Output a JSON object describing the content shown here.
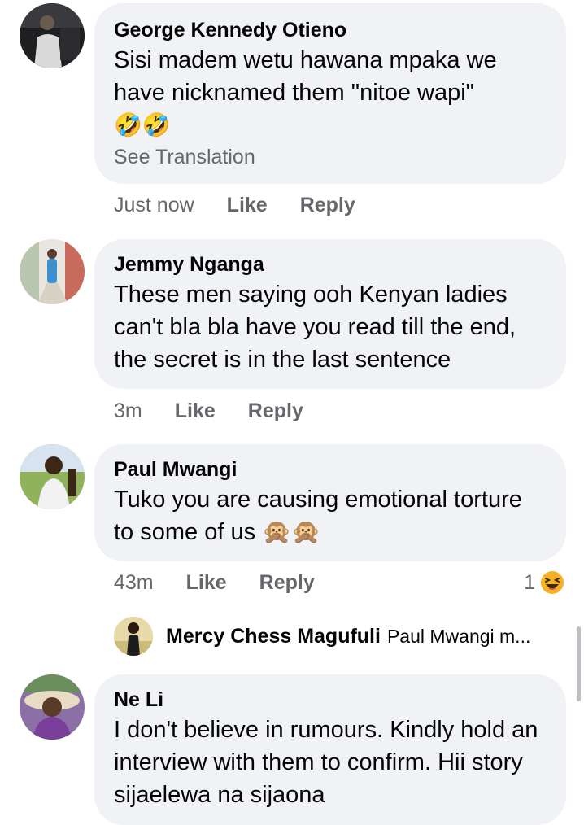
{
  "comments": [
    {
      "name": "George Kennedy Otieno",
      "text": "Sisi madem wetu hawana mpaka we have nicknamed them \"nitoe wapi\"",
      "emoji": "🤣🤣",
      "see_translation": "See Translation",
      "time": "Just now",
      "like": "Like",
      "reply": "Reply"
    },
    {
      "name": "Jemmy Nganga",
      "text": "These men saying ooh Kenyan ladies can't bla bla have you read till the end, the secret is in the last sentence",
      "time": "3m",
      "like": "Like",
      "reply": "Reply"
    },
    {
      "name": "Paul Mwangi",
      "text": "Tuko you are causing emotional torture to some of us",
      "emoji": "🙊🙊",
      "time": "43m",
      "like": "Like",
      "reply": "Reply",
      "reaction_count": "1",
      "reaction_icon": "laughing-emoji-icon",
      "reply_preview": {
        "name": "Mercy Chess Magufuli",
        "snippet": "Paul Mwangi m..."
      }
    },
    {
      "name": "Ne Li",
      "text": "I don't believe in rumours. Kindly hold an interview with them to confirm. Hii story sijaelewa na sijaona"
    }
  ],
  "colors": {
    "bubble": "#f0f2f5",
    "secondary_text": "#65676b",
    "primary_text": "#050505",
    "reaction_yellow": "#f7b125"
  }
}
